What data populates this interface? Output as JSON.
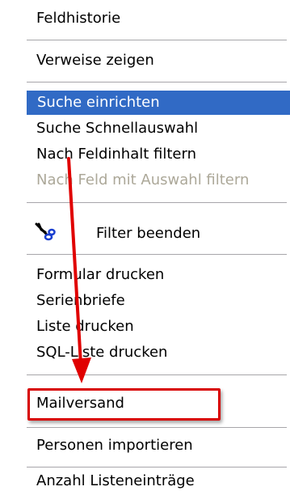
{
  "menu": {
    "feldhistorie": "Feldhistorie",
    "verweise": "Verweise zeigen",
    "suche_einrichten": "Suche einrichten",
    "suche_schnell": "Suche Schnellauswahl",
    "nach_feldinhalt": "Nach Feldinhalt filtern",
    "nach_feld_auswahl": "Nach Feld mit Auswahl filtern",
    "filter_beenden": "Filter beenden",
    "formular_drucken": "Formular drucken",
    "serienbriefe": "Serienbriefe",
    "liste_drucken": "Liste drucken",
    "sql_liste": "SQL-Liste drucken",
    "mailversand": "Mailversand",
    "personen_importieren": "Personen importieren",
    "anzahl_listeneintraege": "Anzahl Listeneinträge"
  },
  "icons": {
    "filter_beenden": "scissors-icon"
  },
  "colors": {
    "highlight": "#316ac5",
    "disabled_text": "#aca899",
    "annotation_red": "#d80000"
  }
}
